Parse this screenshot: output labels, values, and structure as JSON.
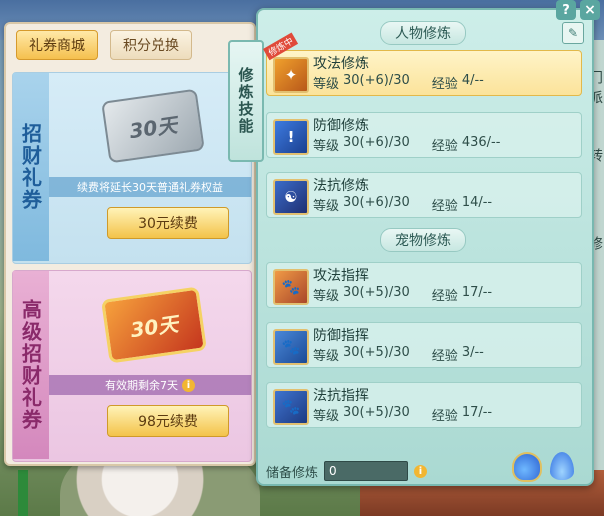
{
  "shop": {
    "tabs": [
      {
        "label": "礼券商城",
        "active": true
      },
      {
        "label": "积分兑换",
        "active": false
      }
    ],
    "cards": [
      {
        "title": "招财礼券",
        "ticket_text": "30天",
        "desc": "续费将延长30天普通礼券权益",
        "button": "30元续费"
      },
      {
        "title": "高级招财礼券",
        "ticket_text": "30天",
        "desc": "有效期剩余7天",
        "button": "98元续费"
      }
    ]
  },
  "cultivation": {
    "side_tab": "修炼技能",
    "help_label": "?",
    "close_label": "×",
    "sections": {
      "character": "人物修炼",
      "pet": "宠物修炼"
    },
    "level_label": "等级",
    "exp_label": "经验",
    "character_skills": [
      {
        "name": "攻法修炼",
        "level": "30(+6)/30",
        "exp": "4/--",
        "icon": "attack-emblem-icon",
        "selected": true,
        "ribbon": "修炼中"
      },
      {
        "name": "防御修炼",
        "level": "30(+6)/30",
        "exp": "436/--",
        "icon": "defense-shield-icon",
        "selected": false
      },
      {
        "name": "法抗修炼",
        "level": "30(+6)/30",
        "exp": "14/--",
        "icon": "resist-yinyang-icon",
        "selected": false
      }
    ],
    "pet_skills": [
      {
        "name": "攻法指挥",
        "level": "30(+5)/30",
        "exp": "17/--",
        "icon": "pet-attack-paw-icon"
      },
      {
        "name": "防御指挥",
        "level": "30(+5)/30",
        "exp": "3/--",
        "icon": "pet-defense-paw-icon"
      },
      {
        "name": "法抗指挥",
        "level": "30(+5)/30",
        "exp": "17/--",
        "icon": "pet-resist-paw-icon"
      }
    ],
    "reserve": {
      "label": "储备修炼",
      "value": "0"
    }
  },
  "world": {
    "right_strip": [
      "门",
      "派",
      "转",
      "修"
    ]
  },
  "colors": {
    "panel_bg": "#bfe6df",
    "selected_row": "#fbe39a",
    "gold_button": "#f3c34a"
  }
}
